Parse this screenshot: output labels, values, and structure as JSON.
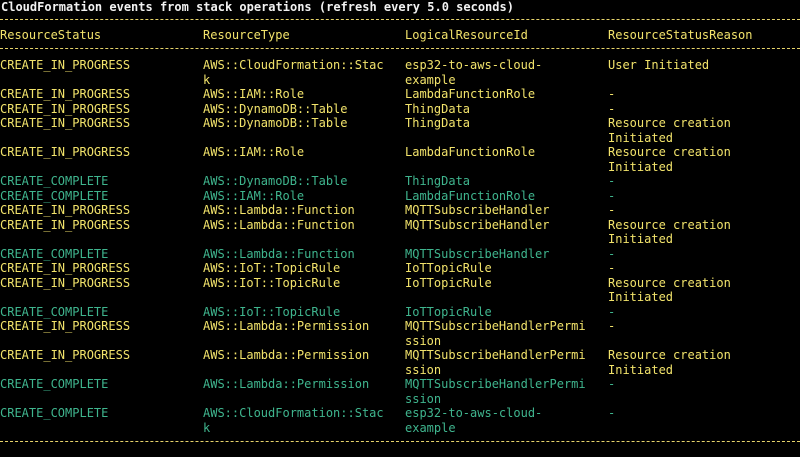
{
  "title": "CloudFormation events from stack operations (refresh every 5.0 seconds)",
  "columns": [
    "ResourceStatus",
    "ResourceType",
    "LogicalResourceId",
    "ResourceStatusReason"
  ],
  "colors": {
    "in_progress": "#f2e36b",
    "complete": "#3fb58e",
    "background": "#000000"
  },
  "rows": [
    {
      "state": "progress",
      "cells": [
        "CREATE_IN_PROGRESS",
        "AWS::CloudFormation::Stac\nk",
        "esp32-to-aws-cloud-\nexample",
        "User Initiated"
      ]
    },
    {
      "state": "progress",
      "cells": [
        "CREATE_IN_PROGRESS",
        "AWS::IAM::Role",
        "LambdaFunctionRole",
        "-"
      ]
    },
    {
      "state": "progress",
      "cells": [
        "CREATE_IN_PROGRESS",
        "AWS::DynamoDB::Table",
        "ThingData",
        "-"
      ]
    },
    {
      "state": "progress",
      "cells": [
        "CREATE_IN_PROGRESS",
        "AWS::DynamoDB::Table",
        "ThingData",
        "Resource creation\nInitiated"
      ]
    },
    {
      "state": "progress",
      "cells": [
        "CREATE_IN_PROGRESS",
        "AWS::IAM::Role",
        "LambdaFunctionRole",
        "Resource creation\nInitiated"
      ]
    },
    {
      "state": "complete",
      "cells": [
        "CREATE_COMPLETE",
        "AWS::DynamoDB::Table",
        "ThingData",
        "-"
      ]
    },
    {
      "state": "complete",
      "cells": [
        "CREATE_COMPLETE",
        "AWS::IAM::Role",
        "LambdaFunctionRole",
        "-"
      ]
    },
    {
      "state": "progress",
      "cells": [
        "CREATE_IN_PROGRESS",
        "AWS::Lambda::Function",
        "MQTTSubscribeHandler",
        "-"
      ]
    },
    {
      "state": "progress",
      "cells": [
        "CREATE_IN_PROGRESS",
        "AWS::Lambda::Function",
        "MQTTSubscribeHandler",
        "Resource creation\nInitiated"
      ]
    },
    {
      "state": "complete",
      "cells": [
        "CREATE_COMPLETE",
        "AWS::Lambda::Function",
        "MQTTSubscribeHandler",
        "-"
      ]
    },
    {
      "state": "progress",
      "cells": [
        "CREATE_IN_PROGRESS",
        "AWS::IoT::TopicRule",
        "IoTTopicRule",
        "-"
      ]
    },
    {
      "state": "progress",
      "cells": [
        "CREATE_IN_PROGRESS",
        "AWS::IoT::TopicRule",
        "IoTTopicRule",
        "Resource creation\nInitiated"
      ]
    },
    {
      "state": "complete",
      "cells": [
        "CREATE_COMPLETE",
        "AWS::IoT::TopicRule",
        "IoTTopicRule",
        "-"
      ]
    },
    {
      "state": "progress",
      "cells": [
        "CREATE_IN_PROGRESS",
        "AWS::Lambda::Permission",
        "MQTTSubscribeHandlerPermi\nssion",
        "-"
      ]
    },
    {
      "state": "progress",
      "cells": [
        "CREATE_IN_PROGRESS",
        "AWS::Lambda::Permission",
        "MQTTSubscribeHandlerPermi\nssion",
        "Resource creation\nInitiated"
      ]
    },
    {
      "state": "complete",
      "cells": [
        "CREATE_COMPLETE",
        "AWS::Lambda::Permission",
        "MQTTSubscribeHandlerPermi\nssion",
        "-"
      ]
    },
    {
      "state": "complete",
      "cells": [
        "CREATE_COMPLETE",
        "AWS::CloudFormation::Stac\nk",
        "esp32-to-aws-cloud-\nexample",
        "-"
      ]
    }
  ]
}
